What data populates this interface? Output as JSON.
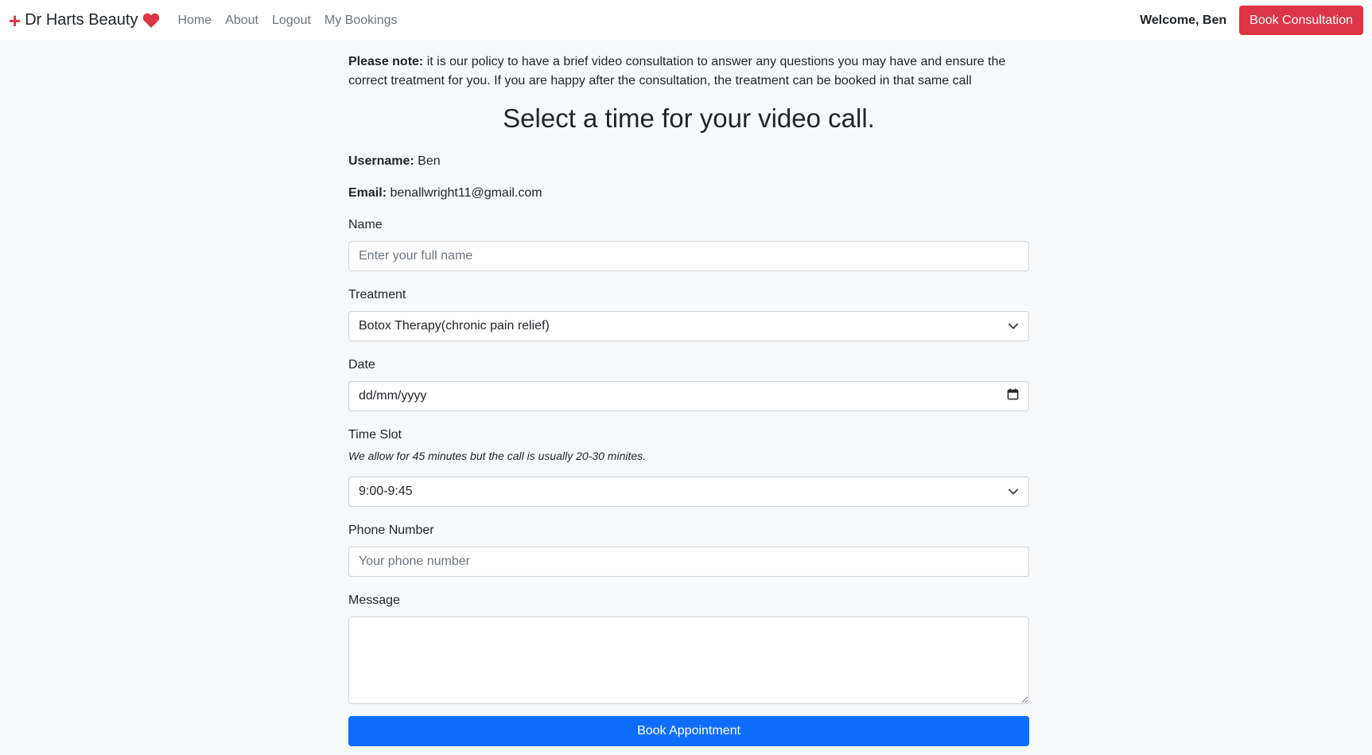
{
  "navbar": {
    "brand": "Dr Harts Beauty",
    "links": [
      "Home",
      "About",
      "Logout",
      "My Bookings"
    ],
    "welcome": "Welcome, Ben",
    "consult_button": "Book Consultation"
  },
  "note": {
    "bold": "Please note:",
    "text": " it is our policy to have a brief video consultation to answer any questions you may have and ensure the correct treatment for you. If you are happy after the consultation, the treatment can be booked in that same call"
  },
  "heading": "Select a time for your video call.",
  "user": {
    "username_label": "Username:",
    "username": "Ben",
    "email_label": "Email:",
    "email": "benallwright11@gmail.com"
  },
  "form": {
    "name_label": "Name",
    "name_placeholder": "Enter your full name",
    "treatment_label": "Treatment",
    "treatment_value": "Botox Therapy(chronic pain relief)",
    "date_label": "Date",
    "date_placeholder": "dd/mm/yyyy",
    "timeslot_label": "Time Slot",
    "timeslot_hint": "We allow for 45 minutes but the call is usually 20-30 minites.",
    "timeslot_value": "9:00-9:45",
    "phone_label": "Phone Number",
    "phone_placeholder": "Your phone number",
    "message_label": "Message",
    "submit_label": "Book Appointment"
  },
  "colors": {
    "brand_red": "#dc3545",
    "primary_blue": "#0d6efd",
    "background": "#f8f9fa"
  }
}
